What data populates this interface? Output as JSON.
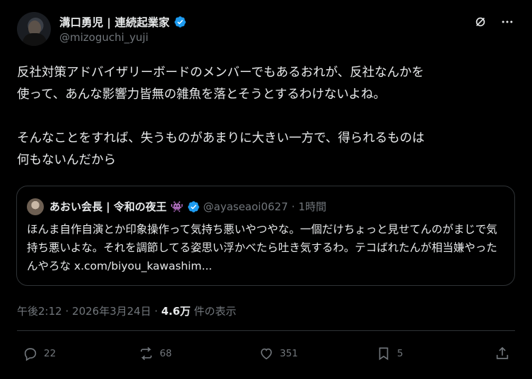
{
  "author": {
    "name": "溝口勇児 | 連続起業家",
    "handle": "@mizoguchi_yuji"
  },
  "tweet": {
    "text": "反社対策アドバイザリーボードのメンバーでもあるおれが、反社なんかを\n使って、あんな影響力皆無の雑魚を落とそうとするわけないよね。\n\nそんなことをすれば、失うものがあまりに大きい一方で、得られるものは\n何もないんだから"
  },
  "quoted": {
    "name": "あおい会長 | 令和の夜王",
    "emoji": "👾",
    "handle": "@ayaseaoi0627",
    "separator": "·",
    "time": "1時間",
    "text": "ほんま自作自演とか印象操作って気持ち悪いやつやな。一個だけちょっと見せてんのがまじで気持ち悪いよな。それを調節してる姿思い浮かべたら吐き気するわ。テコばれたんが相当嫌やったんやろな x.com/biyou_kawashim..."
  },
  "meta": {
    "time": "午後2:12",
    "separator1": "·",
    "date": "2026年3月24日",
    "separator2": "·",
    "views": "4.6万",
    "views_label": "件の表示"
  },
  "actions": {
    "replies": "22",
    "reposts": "68",
    "likes": "351",
    "bookmarks": "5"
  },
  "colors": {
    "background": "#000000",
    "text": "#e7e9ea",
    "secondary": "#71767b",
    "border": "#2f3336",
    "verified": "#1d9bf0"
  },
  "icons": [
    "grok-icon",
    "more-icon",
    "reply-icon",
    "repost-icon",
    "like-icon",
    "bookmark-icon",
    "share-icon"
  ]
}
